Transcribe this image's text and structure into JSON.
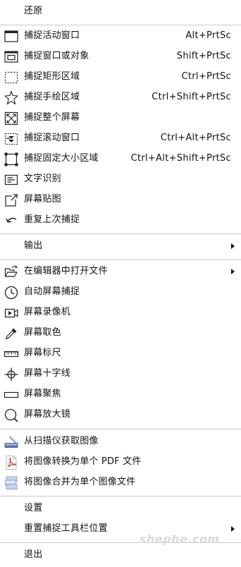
{
  "menu": {
    "restore": {
      "label": "还原"
    },
    "active_window": {
      "label": "捕捉活动窗口",
      "shortcut": "Alt+PrtSc",
      "icon": "active-window-icon"
    },
    "window_or_object": {
      "label": "捕捉窗口或对象",
      "shortcut": "Shift+PrtSc",
      "icon": "window-object-icon"
    },
    "rect_region": {
      "label": "捕捉矩形区域",
      "shortcut": "Ctrl+PrtSc",
      "icon": "dotted-rectangle-icon"
    },
    "freehand_region": {
      "label": "捕捉手绘区域",
      "shortcut": "Ctrl+Shift+PrtSc",
      "icon": "freehand-star-icon"
    },
    "full_screen": {
      "label": "捕捉整个屏幕",
      "icon": "fullscreen-icon"
    },
    "scrolling_window": {
      "label": "捕捉滚动窗口",
      "shortcut": "Ctrl+Alt+PrtSc",
      "icon": "scroll-window-icon"
    },
    "fixed_region": {
      "label": "捕捉固定大小区域",
      "shortcut": "Ctrl+Alt+Shift+PrtSc",
      "icon": "fixed-region-icon"
    },
    "ocr": {
      "label": "文字识别",
      "icon": "text-recognition-icon"
    },
    "pin_screen": {
      "label": "屏幕贴图",
      "icon": "pin-image-icon"
    },
    "repeat_last": {
      "label": "重复上次捕捉",
      "icon": "repeat-icon"
    },
    "output": {
      "label": "输出"
    },
    "open_in_editor": {
      "label": "在编辑器中打开文件",
      "icon": "open-folder-icon"
    },
    "auto_capture": {
      "label": "自动屏幕捕捉",
      "icon": "clock-icon"
    },
    "screen_recorder": {
      "label": "屏幕录像机",
      "icon": "video-camera-icon"
    },
    "color_picker": {
      "label": "屏幕取色",
      "icon": "eyedropper-icon"
    },
    "ruler": {
      "label": "屏幕标尺",
      "icon": "ruler-icon"
    },
    "crosshair": {
      "label": "屏幕十字线",
      "icon": "crosshair-icon"
    },
    "focus": {
      "label": "屏幕聚焦",
      "icon": "focus-bar-icon"
    },
    "magnifier": {
      "label": "屏幕放大镜",
      "icon": "magnifier-icon"
    },
    "scanner": {
      "label": "从扫描仪获取图像",
      "icon": "scanner-icon"
    },
    "to_pdf": {
      "label": "将图像转换为单个 PDF 文件",
      "icon": "pdf-icon"
    },
    "merge_images": {
      "label": "将图像合并为单个图像文件",
      "icon": "merge-images-icon"
    },
    "settings": {
      "label": "设置"
    },
    "reset_toolbar": {
      "label": "重置捕捉工具栏位置"
    },
    "exit": {
      "label": "退出"
    }
  },
  "watermark": "shephe.com",
  "colors": {
    "separator": "#c9c9c9",
    "pdf_red": "#d9312a",
    "scanner_blue": "#5a6fa8",
    "merge_blue": "#9db3d9"
  }
}
